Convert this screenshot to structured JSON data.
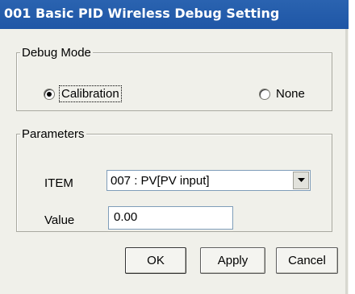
{
  "window": {
    "title": "001 Basic PID Wireless Debug Setting"
  },
  "debug_mode": {
    "legend": "Debug Mode",
    "options": [
      {
        "label": "Calibration",
        "selected": true
      },
      {
        "label": "None",
        "selected": false
      }
    ]
  },
  "parameters": {
    "legend": "Parameters",
    "item_label": "ITEM",
    "item_selected": "007 : PV[PV input]",
    "value_label": "Value",
    "value": "0.00"
  },
  "buttons": {
    "ok": "OK",
    "apply": "Apply",
    "cancel": "Cancel"
  },
  "colors": {
    "titlebar": "#1f56a6",
    "dialog_bg": "#f0f0ea"
  }
}
